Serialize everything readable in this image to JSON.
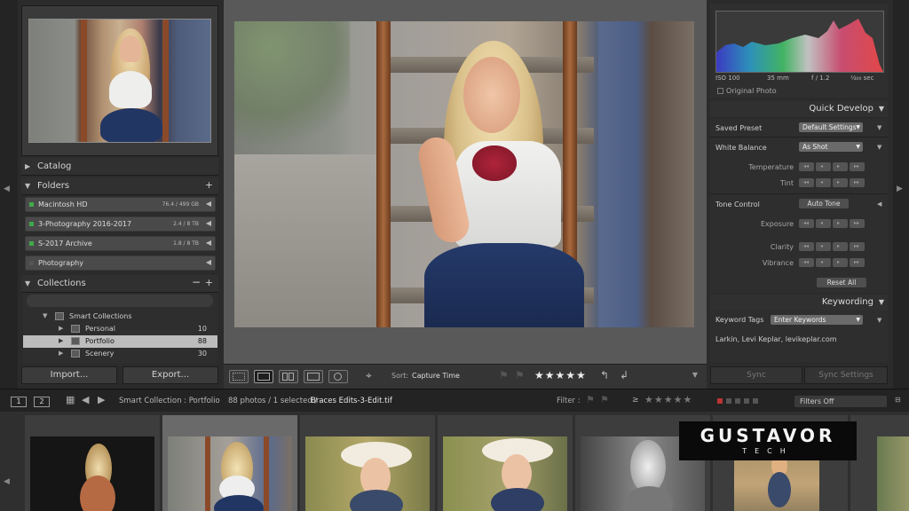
{
  "left_panel": {
    "sections": {
      "catalog": "Catalog",
      "folders": "Folders",
      "collections": "Collections"
    },
    "volumes": [
      {
        "name": "Macintosh HD",
        "size": "76.4 / 499 GB"
      },
      {
        "name": "3-Photography 2016-2017",
        "size": "2.4 / 8 TB"
      },
      {
        "name": "S-2017 Archive",
        "size": "1.8 / 8 TB"
      },
      {
        "name": "Photography",
        "size": ""
      }
    ],
    "collections": [
      {
        "label": "Smart Collections",
        "count": ""
      },
      {
        "label": "Personal",
        "count": "10"
      },
      {
        "label": "Portfolio",
        "count": "88"
      },
      {
        "label": "Scenery",
        "count": "30"
      }
    ],
    "import_label": "Import...",
    "export_label": "Export..."
  },
  "toolbar": {
    "sort_label": "Sort:",
    "sort_value": "Capture Time",
    "stars": "★★★★★"
  },
  "right_panel": {
    "histogram": {
      "iso": "ISO 100",
      "focal": "35 mm",
      "aperture": "f / 1.2",
      "shutter": "¹⁄₄₀₀ sec",
      "original_photo": "Original Photo"
    },
    "quick_develop": {
      "title": "Quick Develop",
      "saved_preset_label": "Saved Preset",
      "saved_preset_value": "Default Settings",
      "white_balance_label": "White Balance",
      "white_balance_value": "As Shot",
      "temperature": "Temperature",
      "tint": "Tint",
      "tone_control": "Tone Control",
      "auto_tone": "Auto Tone",
      "exposure": "Exposure",
      "clarity": "Clarity",
      "vibrance": "Vibrance",
      "reset_all": "Reset All"
    },
    "keywording": {
      "title": "Keywording",
      "keyword_tags_label": "Keyword Tags",
      "keyword_tags_value": "Enter Keywords",
      "keywords": "Larkin, Levi Keplar, levikeplar.com"
    },
    "sync_label": "Sync",
    "sync_settings_label": "Sync Settings"
  },
  "filmstrip_header": {
    "monitor1": "1",
    "monitor2": "2",
    "source": "Smart Collection : Portfolio",
    "count": "88 photos / 1 selected /",
    "file": "Braces Edits-3-Edit.tif",
    "filter_label": "Filter :",
    "filter_stars": "★★★★★",
    "filters_off": "Filters Off"
  },
  "watermark": {
    "top": "GUSTAVOR",
    "bottom": "TECH"
  },
  "colors": {
    "selection": "#bcbcbc",
    "accent_green": "#3fa94a"
  }
}
